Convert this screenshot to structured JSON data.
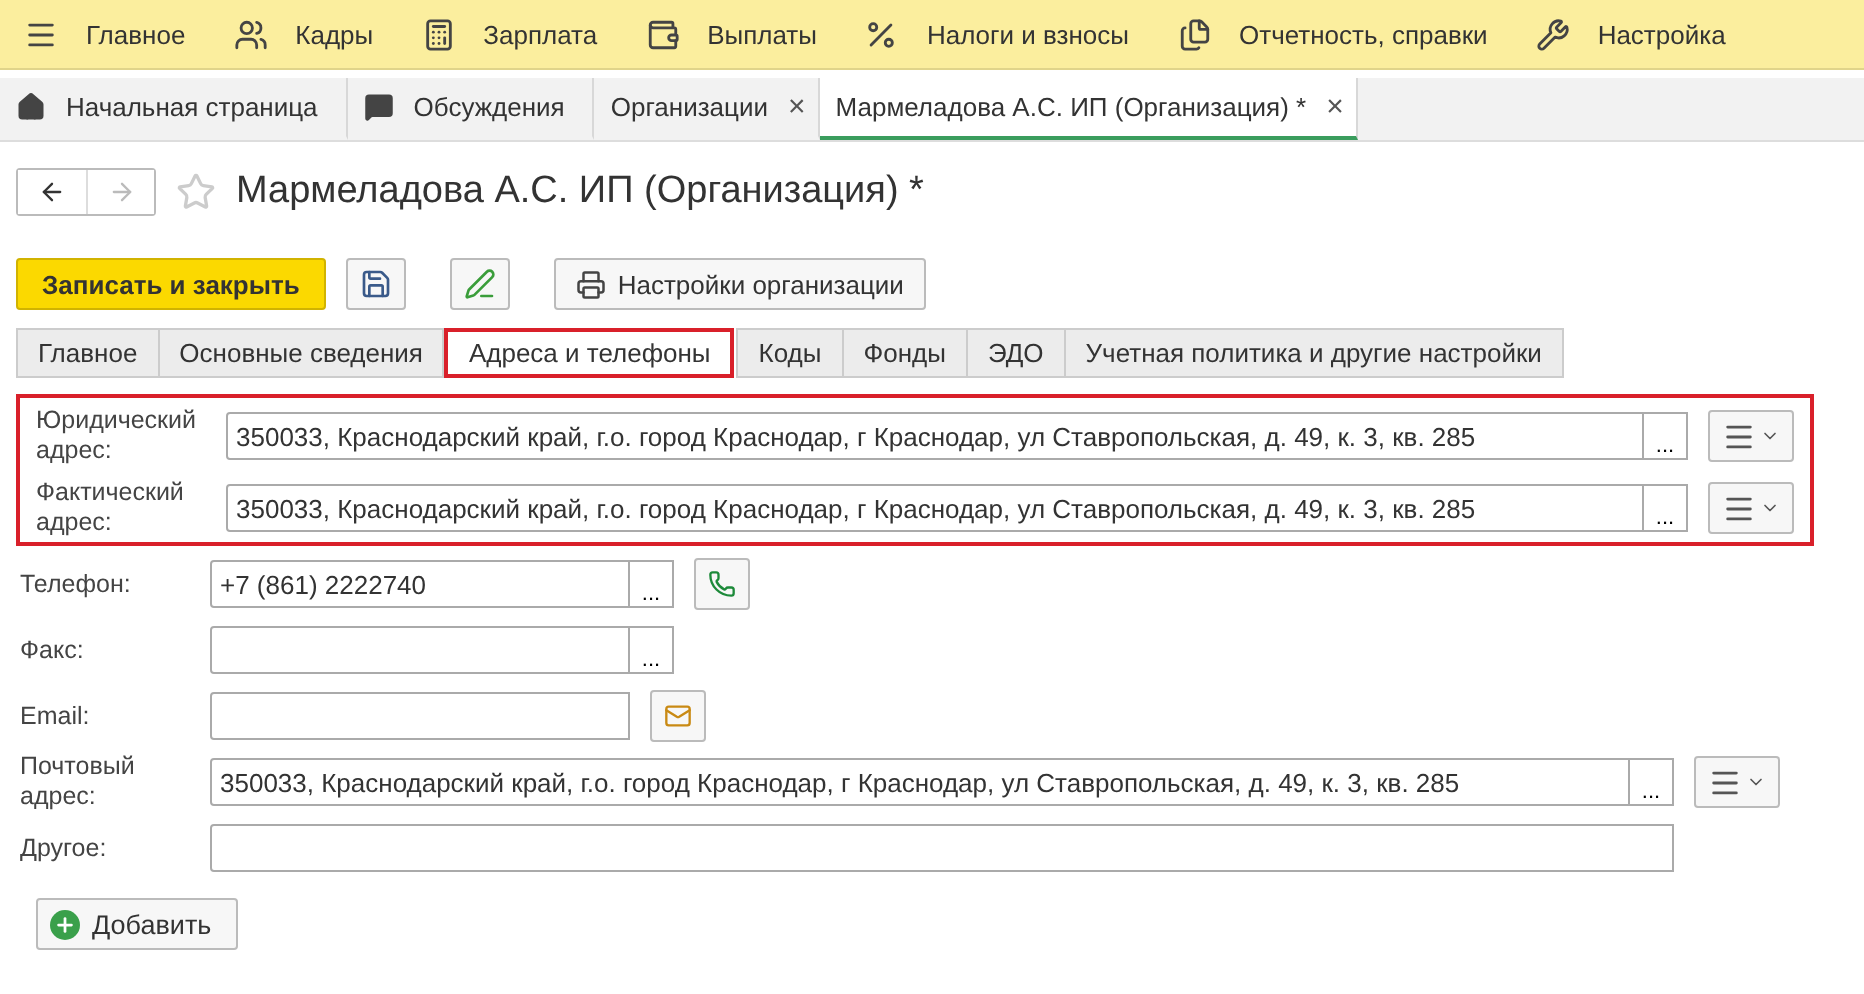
{
  "main_menu": [
    {
      "label": "Главное"
    },
    {
      "label": "Кадры"
    },
    {
      "label": "Зарплата"
    },
    {
      "label": "Выплаты"
    },
    {
      "label": "Налоги и взносы"
    },
    {
      "label": "Отчетность, справки"
    },
    {
      "label": "Настройка"
    }
  ],
  "open_tabs": [
    {
      "label": "Начальная страница",
      "selected": false
    },
    {
      "label": "Обсуждения",
      "selected": false
    },
    {
      "label": "Организации",
      "close": "×",
      "selected": false
    },
    {
      "label": "Мармеладова А.С. ИП (Организация) *",
      "close": "×",
      "selected": true
    }
  ],
  "title": "Мармеладова А.С. ИП (Организация) *",
  "toolbar": {
    "save_close": "Записать и закрыть",
    "settings": "Настройки организации"
  },
  "form_tabs": [
    {
      "label": "Главное",
      "selected": false,
      "highlighted": false
    },
    {
      "label": "Основные сведения",
      "selected": false,
      "highlighted": false
    },
    {
      "label": "Адреса и телефоны",
      "selected": true,
      "highlighted": true
    },
    {
      "label": "Коды",
      "selected": false,
      "highlighted": false
    },
    {
      "label": "Фонды",
      "selected": false,
      "highlighted": false
    },
    {
      "label": "ЭДО",
      "selected": false,
      "highlighted": false
    },
    {
      "label": "Учетная политика и другие настройки",
      "selected": false,
      "highlighted": false
    }
  ],
  "field_groups": [
    {
      "highlighted": true,
      "fields": [
        {
          "kind": "address",
          "label": "Юридический адрес:",
          "value": "350033, Краснодарский край, г.о. город Краснодар, г Краснодар, ул Ставропольская, д. 49, к. 3, кв. 285",
          "picker": "..."
        },
        {
          "kind": "address",
          "label": "Фактический адрес:",
          "value": "350033, Краснодарский край, г.о. город Краснодар, г Краснодар, ул Ставропольская, д. 49, к. 3, кв. 285",
          "picker": "..."
        }
      ]
    },
    {
      "highlighted": false,
      "fields": [
        {
          "kind": "phone",
          "label": "Телефон:",
          "value": "+7 (861) 2222740",
          "picker": "..."
        },
        {
          "kind": "fax",
          "label": "Факс:",
          "picker": "..."
        },
        {
          "kind": "email",
          "label": "Email:"
        },
        {
          "kind": "address",
          "label": "Почтовый адрес:",
          "value": "350033, Краснодарский край, г.о. город Краснодар, г Краснодар, ул Ставропольская, д. 49, к. 3, кв. 285",
          "picker": "..."
        },
        {
          "kind": "text",
          "label": "Другое:"
        }
      ]
    }
  ],
  "add_button": "Добавить"
}
